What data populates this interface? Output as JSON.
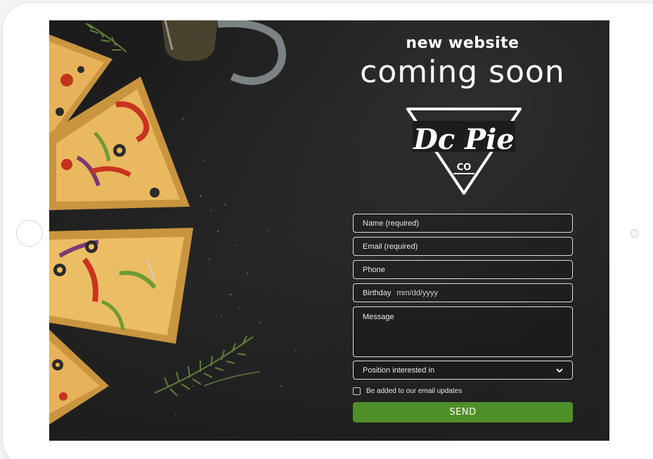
{
  "heading": {
    "line1": "new website",
    "line2": "coming soon"
  },
  "logo": {
    "text": "Dc Pie",
    "sub": "CO"
  },
  "form": {
    "name_placeholder": "Name (required)",
    "email_placeholder": "Email (required)",
    "phone_placeholder": "Phone",
    "birthday_label": "Birthday",
    "birthday_format": "mm/dd/yyyy",
    "message_placeholder": "Message",
    "position_select": "Position interested in",
    "updates_checkbox": "Be added to our email updates",
    "send_label": "SEND"
  },
  "colors": {
    "background": "#1c1c1c",
    "send_button": "#4f8f2a",
    "field_border": "#d9d9d9"
  },
  "icons": {
    "select": "chevron-down-icon"
  }
}
